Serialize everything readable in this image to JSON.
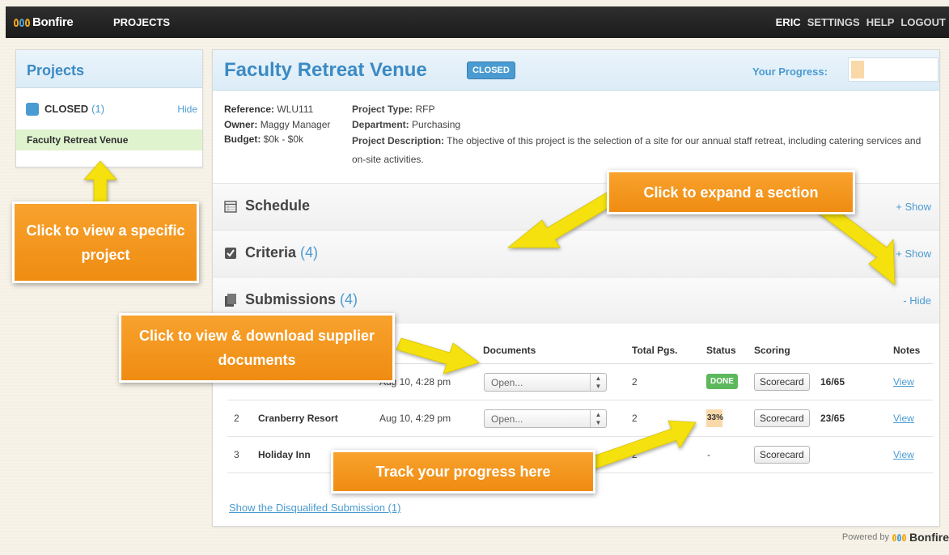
{
  "topbar": {
    "logo": "Bonfire",
    "nav_projects": "PROJECTS",
    "user": "ERIC",
    "settings": "SETTINGS",
    "help": "HELP",
    "logout": "LOGOUT"
  },
  "sidebar": {
    "title": "Projects",
    "status_label": "CLOSED",
    "status_count": "(1)",
    "hide": "Hide",
    "project": "Faculty Retreat Venue"
  },
  "project": {
    "title": "Faculty Retreat Venue",
    "badge": "CLOSED",
    "progress_label": "Your Progress:",
    "progress_fraction": 0.15,
    "reference_label": "Reference:",
    "reference": "WLU111",
    "owner_label": "Owner:",
    "owner": "Maggy Manager",
    "budget_label": "Budget:",
    "budget": "$0k - $0k",
    "type_label": "Project Type:",
    "type": "RFP",
    "dept_label": "Department:",
    "dept": "Purchasing",
    "desc_label": "Project Description:",
    "desc": "The objective of this project is the selection of a site for our annual staff retreat, including catering services and on-site activities."
  },
  "sections": {
    "schedule": {
      "title": "Schedule",
      "toggle": "+ Show"
    },
    "criteria": {
      "title": "Criteria",
      "count": "(4)",
      "toggle": "+ Show"
    },
    "submissions": {
      "title": "Submissions",
      "count": "(4)",
      "toggle": "- Hide"
    }
  },
  "table": {
    "headers": {
      "documents": "Documents",
      "pages": "Total Pgs.",
      "status": "Status",
      "scoring": "Scoring",
      "notes": "Notes"
    },
    "rows": [
      {
        "num": "",
        "name": "",
        "date": "Aug 10, 4:28 pm",
        "doc": "Open...",
        "pages": "2",
        "status": "DONE",
        "score_btn": "Scorecard",
        "score": "16/65",
        "notes": "View"
      },
      {
        "num": "2",
        "name": "Cranberry Resort",
        "date": "Aug 10, 4:29 pm",
        "doc": "Open...",
        "pages": "2",
        "status": "33%",
        "score_btn": "Scorecard",
        "score": "23/65",
        "notes": "View"
      },
      {
        "num": "3",
        "name": "Holiday Inn",
        "date": "",
        "doc": "",
        "pages": "2",
        "status": "-",
        "score_btn": "Scorecard",
        "score": "",
        "notes": "View"
      }
    ]
  },
  "disqualified_link": "Show the Disqualifed Submission (1)",
  "powered_by": "Powered by",
  "callouts": {
    "view_project": "Click to view a specific project",
    "expand": "Click to expand a section",
    "download": "Click to view & download supplier documents",
    "progress": "Track your progress here"
  },
  "colors": {
    "accent": "#4a9bd1",
    "callout": "#f39419",
    "done": "#5cb85c",
    "progress": "#f9d9a9"
  }
}
